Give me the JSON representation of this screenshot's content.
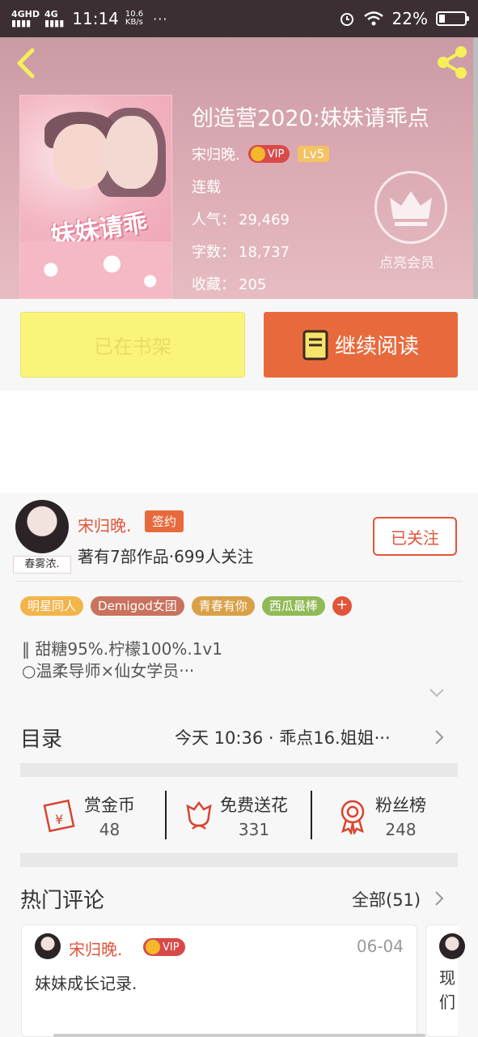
{
  "status_bar": {
    "network1": "4GHD",
    "network2": "4G",
    "time": "11:14",
    "speed_value": "10.6",
    "speed_unit": "KB/s",
    "more": "···",
    "battery": "22%"
  },
  "book": {
    "title": "创造营2020:妹妹请乖点",
    "cover_art_text": "妹妹请乖点",
    "author": "宋归晚.",
    "vip_label": "VIP",
    "level": "Lv5",
    "status": "连载",
    "popularity_label": "人气：",
    "popularity": "29,469",
    "words_label": "字数：",
    "words": "18,737",
    "favorites_label": "收藏：",
    "favorites": "205",
    "member_label": "点亮会员"
  },
  "actions": {
    "shelf_label": "已在书架",
    "read_label": "继续阅读"
  },
  "author": {
    "name": "宋归晚.",
    "sign_badge": "签约",
    "avatar_tag": "春雾浓.",
    "stats": "著有7部作品·699人关注",
    "follow_label": "已关注",
    "tags": [
      {
        "label": "明星同人",
        "color": "#f3b44a"
      },
      {
        "label": "Demigod女团",
        "color": "#c9725e"
      },
      {
        "label": "青春有你",
        "color": "#d9a047"
      },
      {
        "label": "西瓜最棒",
        "color": "#8fba55"
      }
    ],
    "tag_add": "+",
    "desc_line1": "‖ 甜糖95%.柠檬100%.1v1",
    "desc_line2": "○温柔导师×仙女学员···"
  },
  "toc": {
    "label": "目录",
    "latest": "今天 10:36 · 乖点16.姐姐···"
  },
  "gifts": {
    "reward_label": "赏金币",
    "reward_count": "48",
    "flower_label": "免费送花",
    "flower_count": "331",
    "fans_label": "粉丝榜",
    "fans_count": "248"
  },
  "comments": {
    "title": "热门评论",
    "all_label": "全部(51)",
    "items": [
      {
        "name": "宋归晚.",
        "vip": "VIP",
        "date": "06-04",
        "text": "妹妹成长记录."
      },
      {
        "text_line1": "现",
        "text_line2": "们"
      }
    ]
  },
  "colors": {
    "accent": "#e86a3c",
    "author_red": "#e2553a",
    "shelf_yellow": "#fbf47a"
  }
}
